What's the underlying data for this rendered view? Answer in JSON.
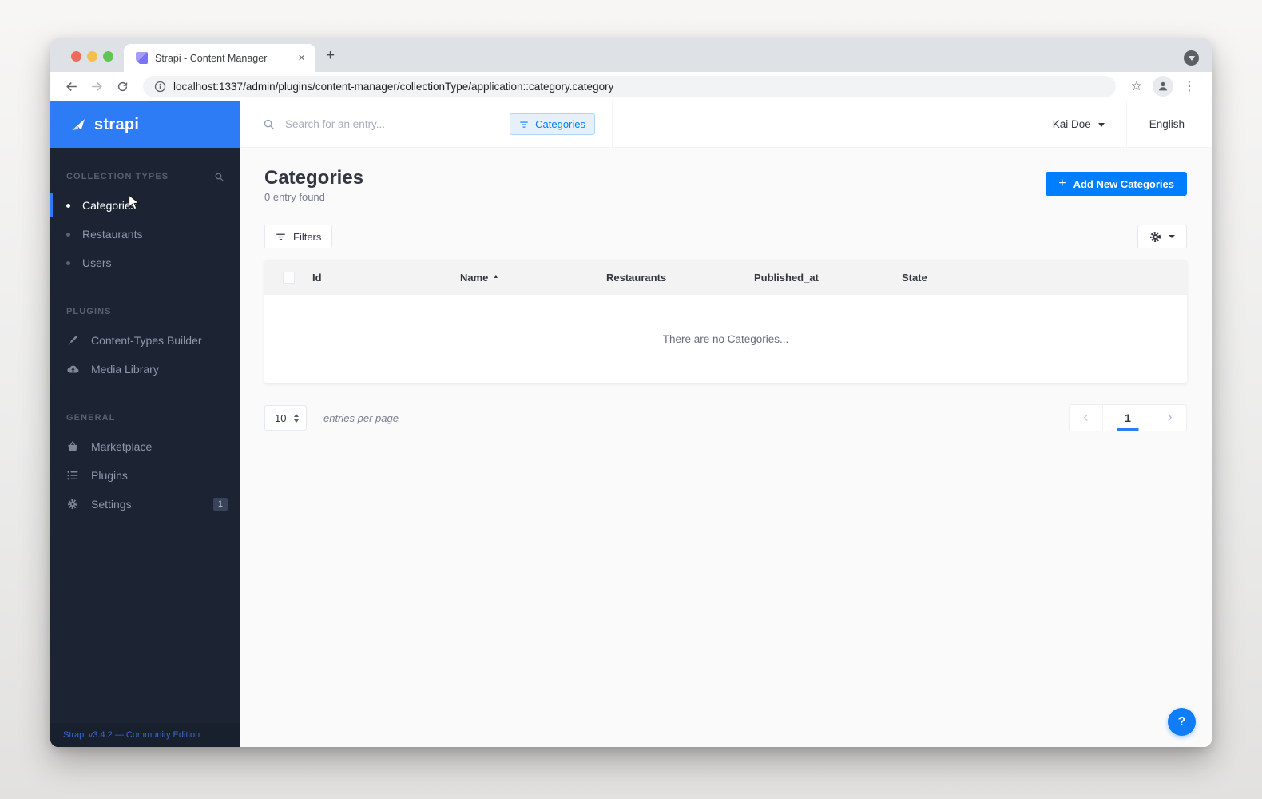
{
  "browser": {
    "tab_title": "Strapi - Content Manager",
    "url": "localhost:1337/admin/plugins/content-manager/collectionType/application::category.category"
  },
  "topbar": {
    "search_placeholder": "Search for an entry...",
    "filter_chip_label": "Categories",
    "user_name": "Kai Doe",
    "language": "English"
  },
  "sidebar": {
    "logo_text": "strapi",
    "sections": [
      {
        "label": "COLLECTION TYPES",
        "items": [
          {
            "label": "Categories"
          },
          {
            "label": "Restaurants"
          },
          {
            "label": "Users"
          }
        ]
      },
      {
        "label": "PLUGINS",
        "items": [
          {
            "label": "Content-Types Builder"
          },
          {
            "label": "Media Library"
          }
        ]
      },
      {
        "label": "GENERAL",
        "items": [
          {
            "label": "Marketplace"
          },
          {
            "label": "Plugins"
          },
          {
            "label": "Settings",
            "badge": "1"
          }
        ]
      }
    ],
    "footer_text": "Strapi v3.4.2 — Community Edition"
  },
  "content": {
    "title": "Categories",
    "entry_count": "0 entry found",
    "add_button_label": "Add New Categories",
    "filters_button_label": "Filters",
    "table": {
      "columns": [
        "Id",
        "Name",
        "Restaurants",
        "Published_at",
        "State"
      ],
      "empty_message": "There are no Categories..."
    },
    "pagination": {
      "entries_per_page_value": "10",
      "entries_per_page_label": "entries per page",
      "current_page": "1"
    }
  },
  "glyphs": {
    "close_tab": "×",
    "new_tab": "+",
    "menu_dots": "⋮",
    "bookmark_star": "☆",
    "plus": "+",
    "sort_asc": "▲",
    "chevron_left": "‹",
    "chevron_right": "›",
    "help": "?"
  },
  "colors": {
    "brand_blue": "#007eff",
    "header_blue": "#2e7cf5",
    "sidebar_bg": "#1c2433",
    "chip_bg": "#e6f0fb",
    "content_bg": "#fafafb"
  }
}
